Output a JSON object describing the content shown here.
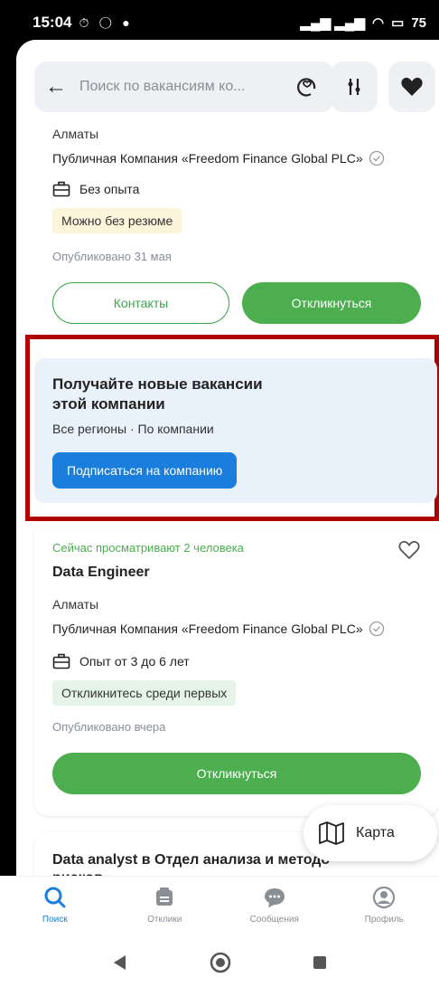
{
  "status": {
    "time": "15:04",
    "battery": "75"
  },
  "search": {
    "placeholder": "Поиск по вакансиям ко..."
  },
  "card1": {
    "city": "Алматы",
    "company": "Публичная Компания «Freedom Finance Global PLC»",
    "experience": "Без опыта",
    "tag": "Можно без резюме",
    "published": "Опубликовано 31 мая",
    "contacts_label": "Контакты",
    "respond_label": "Откликнуться"
  },
  "promo": {
    "title_line1": "Получайте новые вакансии",
    "title_line2": "этой компании",
    "subtitle": "Все регионы · По компании",
    "button_label": "Подписаться на компанию"
  },
  "card2": {
    "viewing": "Сейчас просматривают 2 человека",
    "title": "Data Engineer",
    "city": "Алматы",
    "company": "Публичная Компания «Freedom Finance Global PLC»",
    "experience": "Опыт от 3 до 6 лет",
    "tag": "Откликнитесь среди первых",
    "published": "Опубликовано вчера",
    "respond_label": "Откликнуться"
  },
  "card3": {
    "title_line1": "Data analyst в Отдел анализа и методо",
    "title_line2": "рисков"
  },
  "map_button": {
    "label": "Карта"
  },
  "nav": {
    "search": "Поиск",
    "responses": "Отклики",
    "messages": "Сообщения",
    "profile": "Профиль"
  },
  "colors": {
    "accent_green": "#4cae4f",
    "accent_blue": "#1c7edc",
    "highlight_red": "#b00000"
  }
}
